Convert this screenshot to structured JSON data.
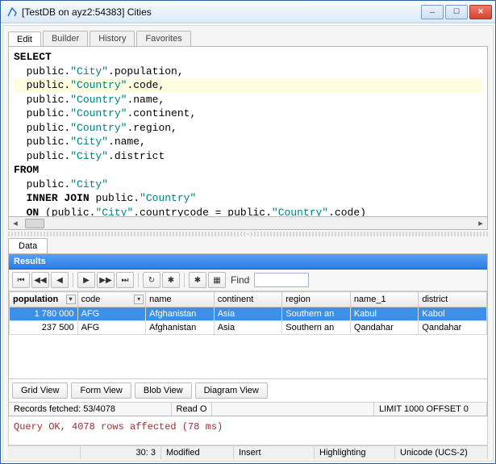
{
  "window": {
    "title": "[TestDB on ayz2:54383] Cities"
  },
  "tabs": [
    "Edit",
    "Builder",
    "History",
    "Favorites"
  ],
  "active_tab": 0,
  "sql_lines": [
    {
      "t": "SELECT",
      "k": true,
      "i": 0
    },
    {
      "t": "public.\"City\".population,",
      "i": 1
    },
    {
      "t": "public.\"Country\".code,",
      "i": 1,
      "hl": true
    },
    {
      "t": "public.\"Country\".name,",
      "i": 1
    },
    {
      "t": "public.\"Country\".continent,",
      "i": 1
    },
    {
      "t": "public.\"Country\".region,",
      "i": 1
    },
    {
      "t": "public.\"City\".name,",
      "i": 1
    },
    {
      "t": "public.\"City\".district",
      "i": 1
    },
    {
      "t": "FROM",
      "k": true,
      "i": 0
    },
    {
      "t": "public.\"City\"",
      "i": 1
    },
    {
      "t": "INNER JOIN public.\"Country\"",
      "i": 1,
      "kpre": "INNER JOIN "
    },
    {
      "t": "ON (public.\"City\".countrycode = public.\"Country\".code)",
      "i": 1,
      "kpre": "ON "
    }
  ],
  "data_tab": "Data",
  "results_header": "Results",
  "toolbar": {
    "first": "⏮",
    "prev": "◀◀",
    "back": "◀",
    "play": "▶",
    "fwd": "▶▶",
    "last": "⏭",
    "refresh": "↻",
    "add": "✱",
    "delsep": "",
    "sparkle": "✱",
    "filter": "▦",
    "find_label": "Find"
  },
  "columns": [
    {
      "name": "population",
      "bold": true,
      "dd": true
    },
    {
      "name": "code",
      "dd": true
    },
    {
      "name": "name"
    },
    {
      "name": "continent"
    },
    {
      "name": "region"
    },
    {
      "name": "name_1"
    },
    {
      "name": "district"
    }
  ],
  "rows": [
    {
      "sel": true,
      "cells": [
        "1 780 000",
        "AFG",
        "Afghanistan",
        "Asia",
        "Southern an",
        "Kabul",
        "Kabol"
      ]
    },
    {
      "sel": false,
      "cells": [
        "237 500",
        "AFG",
        "Afghanistan",
        "Asia",
        "Southern an",
        "Qandahar",
        "Qandahar"
      ]
    }
  ],
  "view_buttons": [
    "Grid View",
    "Form View",
    "Blob View",
    "Diagram View"
  ],
  "status": {
    "records": "Records fetched: 53/4078",
    "read": "Read O",
    "limit": "LIMIT 1000 OFFSET 0"
  },
  "output": "Query OK, 4078 rows affected (78 ms)",
  "bottom": {
    "pos": "30: 3",
    "mod": "Modified",
    "ins": "Insert",
    "hl": "Highlighting",
    "enc": "Unicode (UCS-2)"
  }
}
